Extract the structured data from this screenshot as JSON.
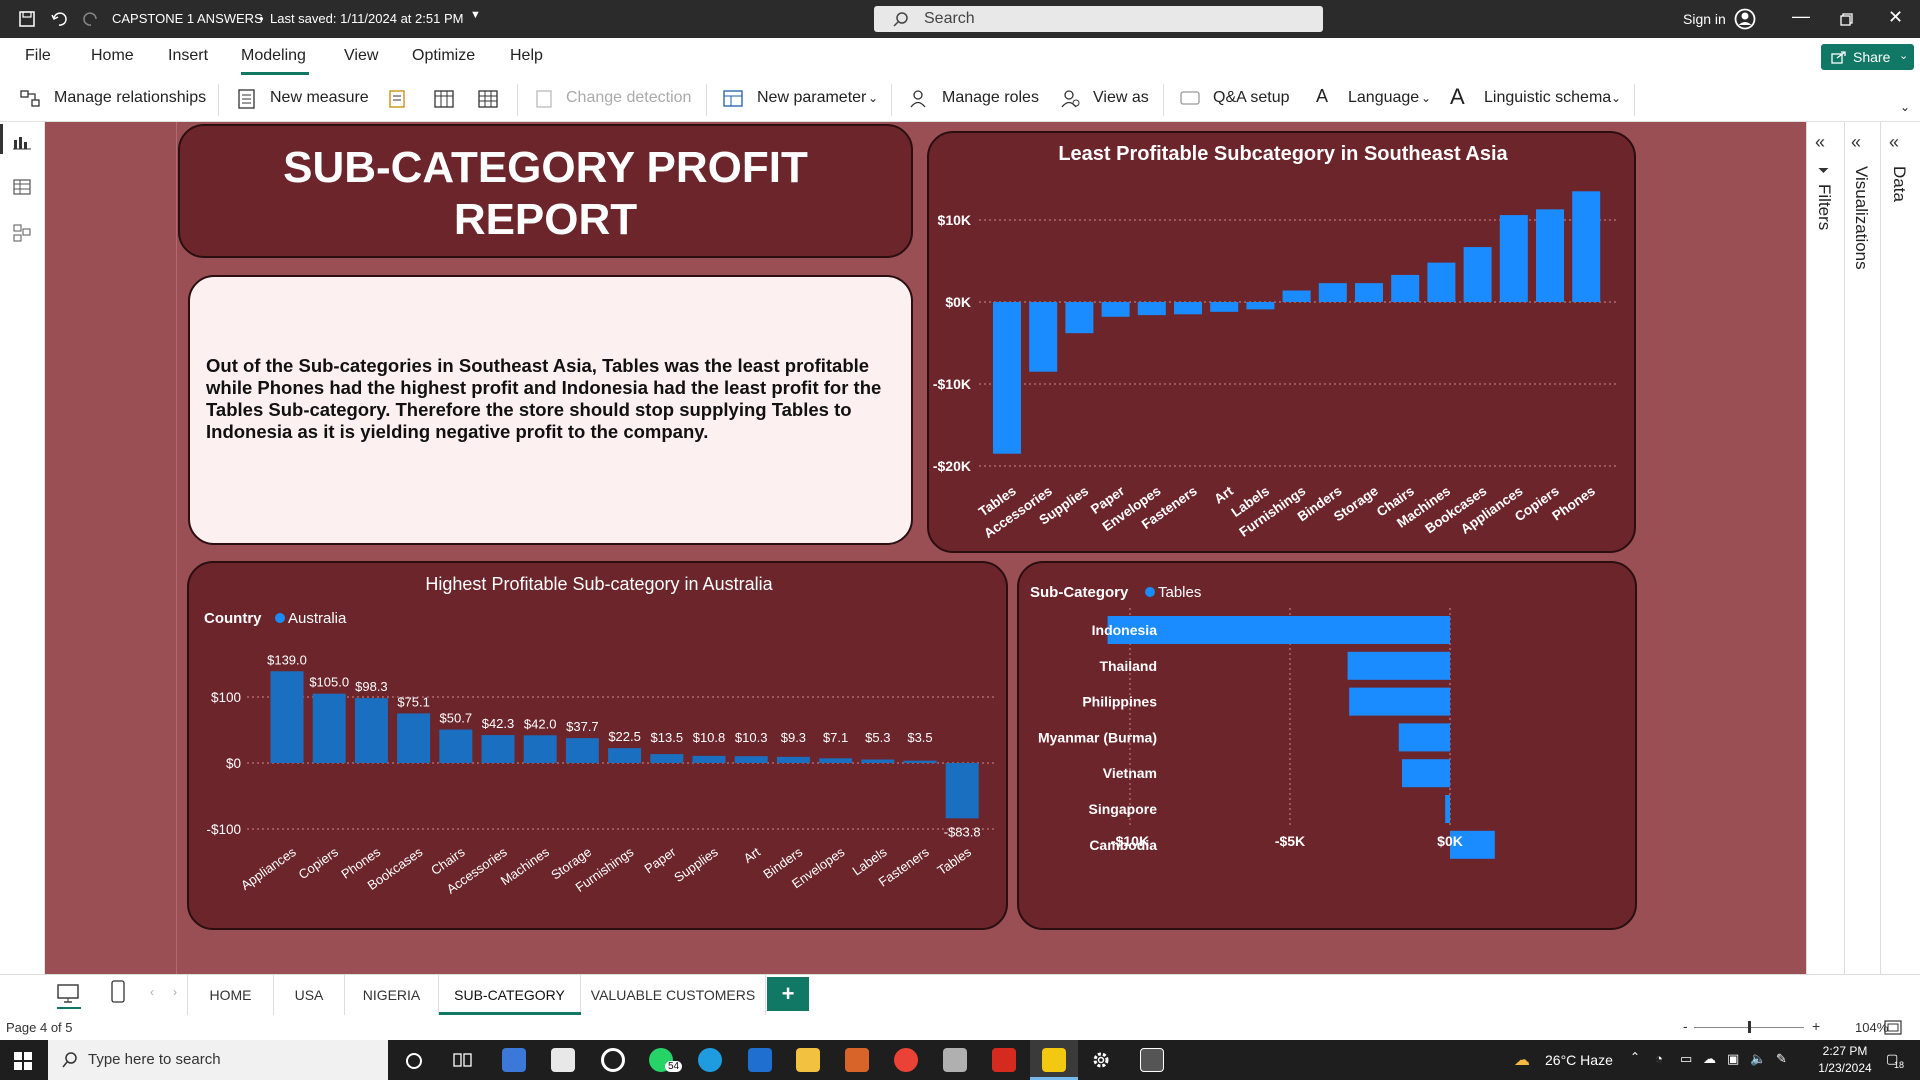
{
  "titlebar": {
    "doc_title": "CAPSTONE 1 ANSWERS",
    "saved": "Last saved: 1/11/2024 at 2:51 PM",
    "search_placeholder": "Search",
    "sign_in": "Sign in"
  },
  "menu": {
    "items": [
      "File",
      "Home",
      "Insert",
      "Modeling",
      "View",
      "Optimize",
      "Help"
    ],
    "active": "Modeling",
    "share": "Share"
  },
  "ribbon": {
    "manage_relationships": "Manage relationships",
    "new_measure": "New measure",
    "change_detection": "Change detection",
    "new_parameter": "New parameter",
    "manage_roles": "Manage roles",
    "view_as": "View as",
    "qa_setup": "Q&A setup",
    "language": "Language",
    "linguistic_schema": "Linguistic schema"
  },
  "panes": {
    "filters": "Filters",
    "visualizations": "Visualizations",
    "data": "Data"
  },
  "report": {
    "title_line1": "SUB-CATEGORY PROFIT",
    "title_line2": "REPORT",
    "insight": "Out of the Sub-categories in Southeast Asia, Tables was the least profitable while Phones had the highest profit and Indonesia had the least profit for the Tables Sub-category. Therefore the store should stop supplying Tables to Indonesia as it is yielding negative profit to the company."
  },
  "chart_data": [
    {
      "type": "bar",
      "title": "Least Profitable Subcategory in Southeast Asia",
      "categories": [
        "Tables",
        "Accessories",
        "Supplies",
        "Paper",
        "Envelopes",
        "Fasteners",
        "Art",
        "Labels",
        "Furnishings",
        "Binders",
        "Storage",
        "Chairs",
        "Machines",
        "Bookcases",
        "Appliances",
        "Copiers",
        "Phones"
      ],
      "values": [
        -18500,
        -8500,
        -3800,
        -1800,
        -1600,
        -1500,
        -1200,
        -900,
        1400,
        2300,
        2300,
        3300,
        4800,
        6700,
        10600,
        11300,
        13500
      ],
      "yticks": [
        "$10K",
        "$0K",
        "-$10K",
        "-$20K"
      ],
      "ylim": [
        -20000,
        15000
      ],
      "color": "#1a8cff"
    },
    {
      "type": "bar",
      "title": "Highest Profitable Sub-category in Australia",
      "legend_title": "Country",
      "legend_item": "Australia",
      "categories": [
        "Appliances",
        "Copiers",
        "Phones",
        "Bookcases",
        "Chairs",
        "Accessories",
        "Machines",
        "Storage",
        "Furnishings",
        "Paper",
        "Supplies",
        "Art",
        "Binders",
        "Envelopes",
        "Labels",
        "Fasteners",
        "Tables"
      ],
      "values": [
        139.0,
        105.0,
        98.3,
        75.1,
        50.7,
        42.3,
        42.0,
        37.7,
        22.5,
        13.5,
        10.8,
        10.3,
        9.3,
        7.1,
        5.3,
        3.5,
        -83.8
      ],
      "labels": [
        "$139.0",
        "$105.0",
        "$98.3",
        "$75.1",
        "$50.7",
        "$42.3",
        "$42.0",
        "$37.7",
        "$22.5",
        "$13.5",
        "$10.8",
        "$10.3",
        "$9.3",
        "$7.1",
        "$5.3",
        "$3.5",
        "-$83.8"
      ],
      "yticks": [
        "$100",
        "$0",
        "-$100"
      ],
      "ylim": [
        -100,
        100
      ],
      "color": "#1a6fc0"
    },
    {
      "type": "bar",
      "orientation": "horizontal",
      "legend_title": "Sub-Category",
      "legend_item": "Tables",
      "categories": [
        "Indonesia",
        "Thailand",
        "Philippines",
        "Myanmar (Burma)",
        "Vietnam",
        "Singapore",
        "Cambodia"
      ],
      "values": [
        -10700,
        -3200,
        -3150,
        -1600,
        -1500,
        -150,
        1400
      ],
      "xticks": [
        "-$10K",
        "-$5K",
        "$0K"
      ],
      "xlim": [
        -10000,
        0
      ],
      "color": "#1a8cff"
    }
  ],
  "tabs": {
    "items": [
      "HOME",
      "USA",
      "NIGERIA",
      "SUB-CATEGORY",
      "VALUABLE CUSTOMERS"
    ],
    "active": "SUB-CATEGORY",
    "add": "+"
  },
  "status": {
    "page": "Page 4 of 5",
    "zoom": "104%"
  },
  "taskbar": {
    "search_placeholder": "Type here to search",
    "whatsapp_badge": "54",
    "weather": "26°C Haze",
    "time": "2:27 PM",
    "date": "1/23/2024",
    "notif": "18"
  }
}
